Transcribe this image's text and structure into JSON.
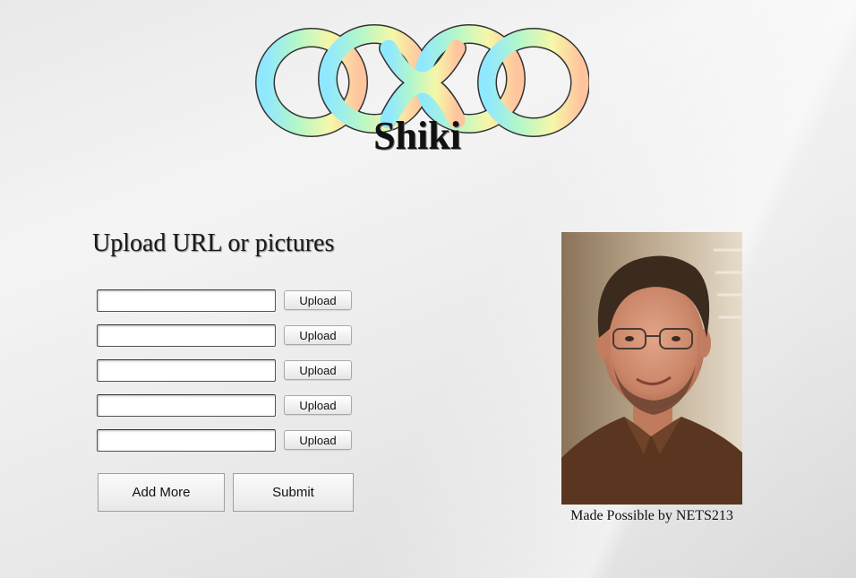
{
  "header": {
    "brand_name": "Shiki",
    "logo_icon": "infinity-knot-icon"
  },
  "upload_form": {
    "heading": "Upload URL or pictures",
    "rows": [
      {
        "url_value": "",
        "upload_label": "Upload"
      },
      {
        "url_value": "",
        "upload_label": "Upload"
      },
      {
        "url_value": "",
        "upload_label": "Upload"
      },
      {
        "url_value": "",
        "upload_label": "Upload"
      },
      {
        "url_value": "",
        "upload_label": "Upload"
      }
    ],
    "add_more_label": "Add More",
    "submit_label": "Submit"
  },
  "sidebar": {
    "photo_subject": "portrait-photo",
    "credit_text": "Made Possible by NETS213"
  },
  "colors": {
    "logo_gradient": [
      "#8fe8ff",
      "#b5f7c9",
      "#f6f7a8",
      "#ffc59e"
    ],
    "background": "#ececec"
  }
}
